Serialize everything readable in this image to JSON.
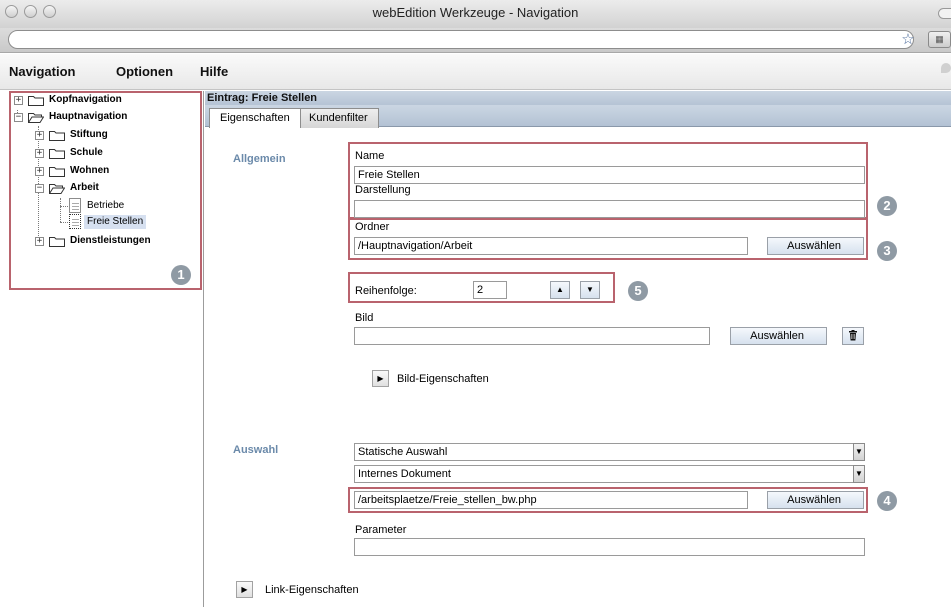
{
  "window": {
    "title": "webEdition Werkzeuge - Navigation"
  },
  "menu": [
    {
      "label": "Navigation"
    },
    {
      "label": "Optionen"
    },
    {
      "label": "Hilfe"
    }
  ],
  "tree": {
    "items": [
      {
        "label": "Kopfnavigation"
      },
      {
        "label": "Hauptnavigation"
      },
      {
        "label": "Stiftung"
      },
      {
        "label": "Schule"
      },
      {
        "label": "Wohnen"
      },
      {
        "label": "Arbeit"
      },
      {
        "label": "Betriebe"
      },
      {
        "label": "Freie Stellen"
      },
      {
        "label": "Dienstleistungen"
      }
    ],
    "expand_symbol": "+",
    "collapse_symbol": "−"
  },
  "annotations": [
    "1",
    "2",
    "3",
    "4",
    "5"
  ],
  "entry": {
    "header": "Eintrag: Freie Stellen"
  },
  "tabs": [
    {
      "label": "Eigenschaften"
    },
    {
      "label": "Kundenfilter"
    }
  ],
  "form": {
    "allgemein_label": "Allgemein",
    "name_label": "Name",
    "name_value": "Freie Stellen",
    "darstellung_label": "Darstellung",
    "darstellung_value": "",
    "ordner_label": "Ordner",
    "ordner_value": "/Hauptnavigation/Arbeit",
    "select_button": "Auswählen",
    "reihenfolge_label": "Reihenfolge:",
    "reihenfolge_value": "2",
    "bild_label": "Bild",
    "bild_value": "",
    "bild_eigenschaften": "Bild-Eigenschaften",
    "auswahl_label": "Auswahl",
    "auswahl_type": "Statische Auswahl",
    "document_type": "Internes Dokument",
    "path_value": "/arbeitsplaetze/Freie_stellen_bw.php",
    "parameter_label": "Parameter",
    "parameter_value": "",
    "link_eigenschaften": "Link-Eigenschaften"
  },
  "colors": {
    "highlight_border": "#b9636d",
    "section_label": "#6b8aaa",
    "header_bg": "#cbd6e3",
    "annotation_circle": "#8f9aa4"
  }
}
